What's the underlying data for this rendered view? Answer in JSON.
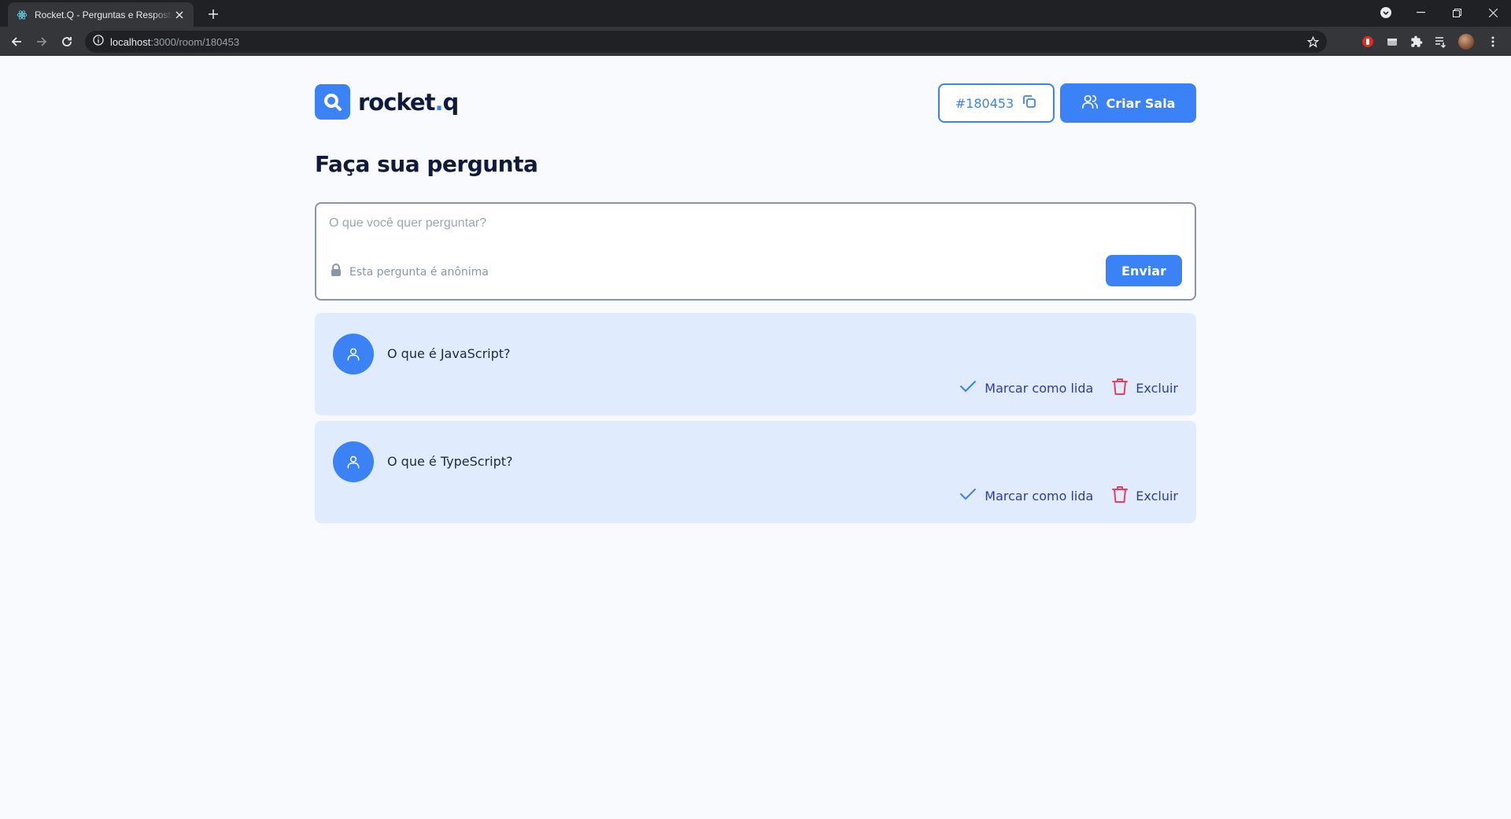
{
  "browser": {
    "tab_title": "Rocket.Q - Perguntas e Respostas",
    "url_host": "localhost",
    "url_path": ":3000/room/180453"
  },
  "header": {
    "logo_text_main": "rocket",
    "logo_text_dot": ".",
    "logo_text_end": "q",
    "room_code": "#180453",
    "create_room_label": "Criar Sala"
  },
  "ask": {
    "title": "Faça sua pergunta",
    "placeholder": "O que você quer perguntar?",
    "anonymous_note": "Esta pergunta é anônima",
    "send_label": "Enviar"
  },
  "questions": [
    {
      "text": "O que é JavaScript?",
      "mark_read_label": "Marcar como lida",
      "delete_label": "Excluir"
    },
    {
      "text": "O que é TypeScript?",
      "mark_read_label": "Marcar como lida",
      "delete_label": "Excluir"
    }
  ],
  "colors": {
    "primary": "#3b82f6",
    "dark_text": "#0f1a3d",
    "question_bg": "#e0ebfd",
    "delete_icon": "#e73f5d"
  }
}
